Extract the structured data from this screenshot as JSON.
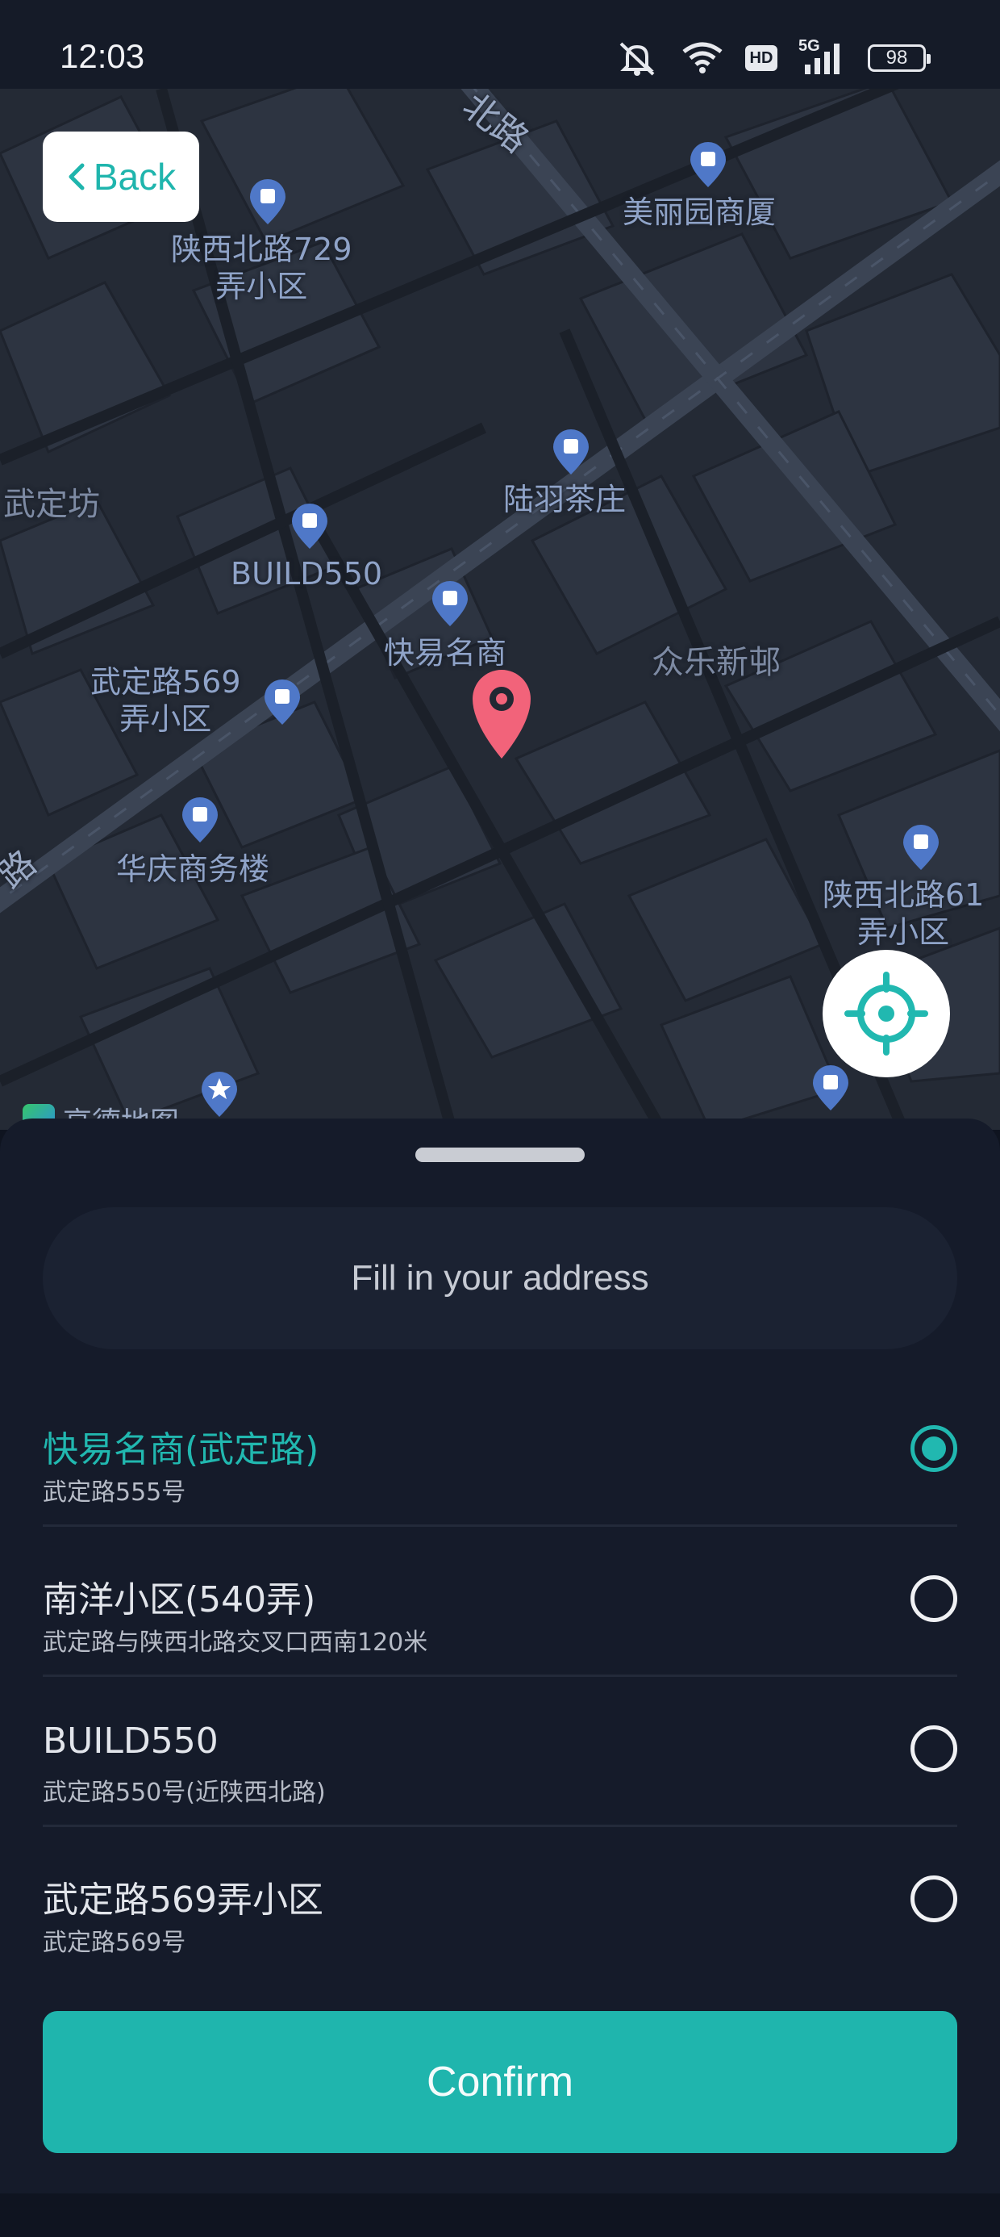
{
  "status_bar": {
    "time": "12:03",
    "network": "5G",
    "hd": "HD",
    "battery": "98"
  },
  "map": {
    "back_label": "Back",
    "pois": [
      {
        "id": "shaanxi729",
        "label": "陕西北路729\n弄小区"
      },
      {
        "id": "meiliyuan",
        "label": "美丽园商厦"
      },
      {
        "id": "luyu",
        "label": "陆羽茶庄"
      },
      {
        "id": "build550",
        "label": "BUILD550"
      },
      {
        "id": "kuaiyi",
        "label": "快易名商"
      },
      {
        "id": "wuding569",
        "label": "武定路569\n弄小区"
      },
      {
        "id": "huaqing",
        "label": "华庆商务楼"
      },
      {
        "id": "shaanxi61",
        "label": "陕西北路61\n弄小区"
      }
    ],
    "areas": [
      {
        "id": "wudingfang",
        "label": "武定坊"
      },
      {
        "id": "zhongle",
        "label": "众乐新邨"
      }
    ],
    "roads": [
      {
        "id": "road-top",
        "label": "北路"
      },
      {
        "id": "road-left",
        "label": "路"
      }
    ],
    "attribution": "高德地图"
  },
  "sheet": {
    "address_placeholder": "Fill in your address",
    "addresses": [
      {
        "name": "快易名商(武定路)",
        "detail": "武定路555号",
        "selected": true
      },
      {
        "name": "南洋小区(540弄)",
        "detail": "武定路与陕西北路交叉口西南120米",
        "selected": false
      },
      {
        "name": "BUILD550",
        "detail": "武定路550号(近陕西北路)",
        "selected": false
      },
      {
        "name": "武定路569弄小区",
        "detail": "武定路569号",
        "selected": false
      }
    ],
    "confirm_label": "Confirm"
  },
  "colors": {
    "accent": "#1fb5ad",
    "map_background": "#222833",
    "pin": "#f2637a",
    "poi": "#4f78c8"
  }
}
